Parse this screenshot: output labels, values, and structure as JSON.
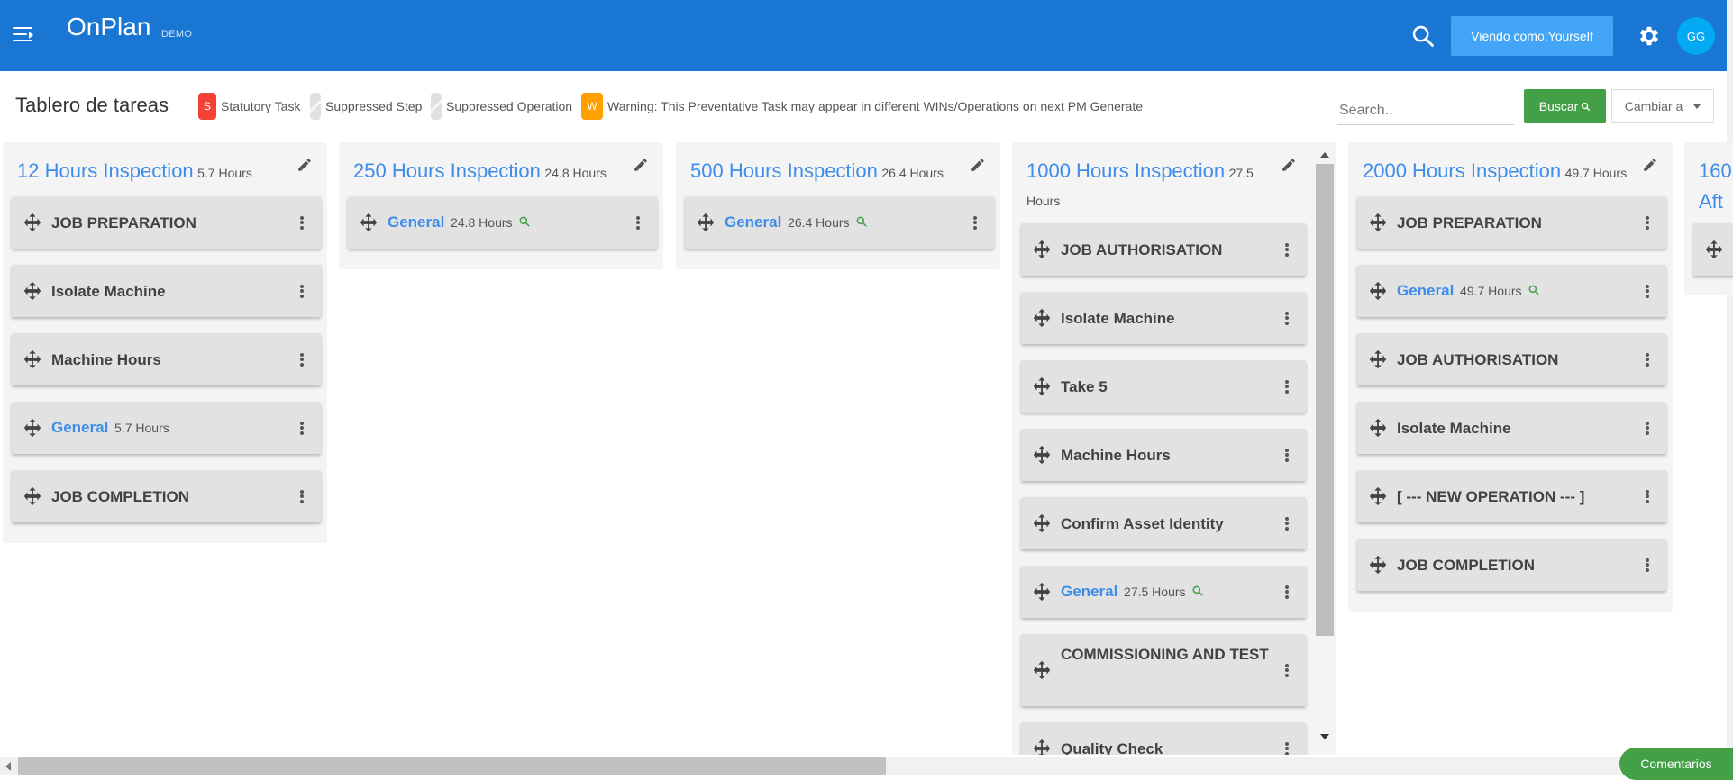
{
  "header": {
    "app_title": "OnPlan",
    "app_tag": "DEMO",
    "view_as_label": "Viendo como:Yourself",
    "avatar_initials": "GG"
  },
  "toolbar": {
    "page_title": "Tablero de tareas",
    "legend": [
      {
        "badge": "S",
        "label": "Statutory Task"
      },
      {
        "badge": "",
        "label": "Suppressed Step"
      },
      {
        "badge": "",
        "label": "Suppressed Operation"
      },
      {
        "badge": "W",
        "label": "Warning: This Preventative Task may appear in different WINs/Operations on next PM Generate"
      }
    ],
    "search_placeholder": "Search..",
    "search_button": "Buscar",
    "switch_button": "Cambiar a"
  },
  "columns": [
    {
      "title": "12 Hours Inspection",
      "hours": "5.7 Hours",
      "cards": [
        {
          "label": "JOB PREPARATION"
        },
        {
          "label": "Isolate Machine"
        },
        {
          "label": "Machine Hours"
        },
        {
          "label": "General",
          "hours": "5.7 Hours"
        },
        {
          "label": "JOB COMPLETION"
        }
      ]
    },
    {
      "title": "250 Hours Inspection",
      "hours": "24.8 Hours",
      "cards": [
        {
          "label": "General",
          "hours": "24.8 Hours"
        }
      ]
    },
    {
      "title": "500 Hours Inspection",
      "hours": "26.4 Hours",
      "cards": [
        {
          "label": "General",
          "hours": "26.4 Hours"
        }
      ]
    },
    {
      "title": "1000 Hours Inspection",
      "hours": "27.5 Hours",
      "cards": [
        {
          "label": "JOB AUTHORISATION"
        },
        {
          "label": "Isolate Machine"
        },
        {
          "label": "Take 5"
        },
        {
          "label": "Machine Hours"
        },
        {
          "label": "Confirm Asset Identity"
        },
        {
          "label": "General",
          "hours": "27.5 Hours"
        },
        {
          "label": "COMMISSIONING AND TEST"
        },
        {
          "label": "Quality Check"
        }
      ]
    },
    {
      "title": "2000 Hours Inspection",
      "hours": "49.7 Hours",
      "cards": [
        {
          "label": "JOB PREPARATION"
        },
        {
          "label": "General",
          "hours": "49.7 Hours"
        },
        {
          "label": "JOB AUTHORISATION"
        },
        {
          "label": "Isolate Machine"
        },
        {
          "label": "[ --- NEW OPERATION --- ]"
        },
        {
          "label": "JOB COMPLETION"
        }
      ]
    },
    {
      "title": "160",
      "title_line2": "Aft"
    }
  ],
  "footer": {
    "comments_label": "Comentarios"
  }
}
